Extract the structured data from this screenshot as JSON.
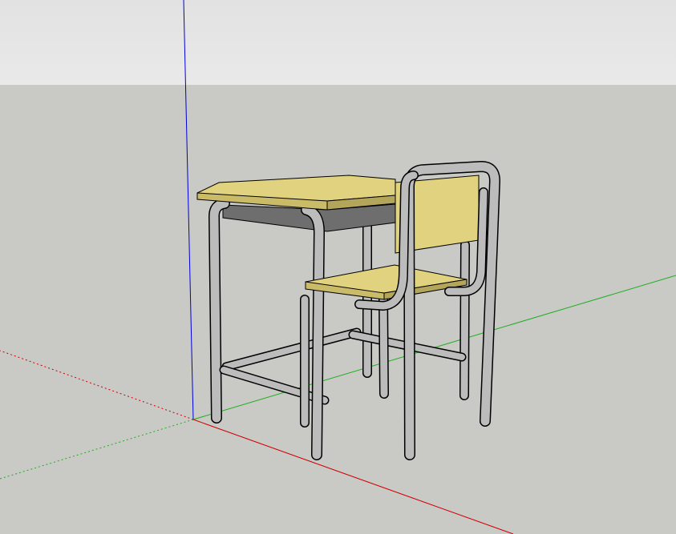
{
  "viewport": {
    "sky_color": "#e9e9e9",
    "sky_gradient_top": "#e2e2e2",
    "ground_color": "#c9c9c6",
    "axis_colors": {
      "x": "#d10000",
      "y": "#1fae1f",
      "z": "#0000d8"
    }
  },
  "model": {
    "wood_color": "#e0d27e",
    "wood_shade_color": "#c9bb68",
    "wood_edge_color": "#b3a55a",
    "metal_color": "#bcbcbc",
    "metal_highlight": "#dedede",
    "drawer_color": "#6e6e6e",
    "outline_color": "#000000"
  }
}
